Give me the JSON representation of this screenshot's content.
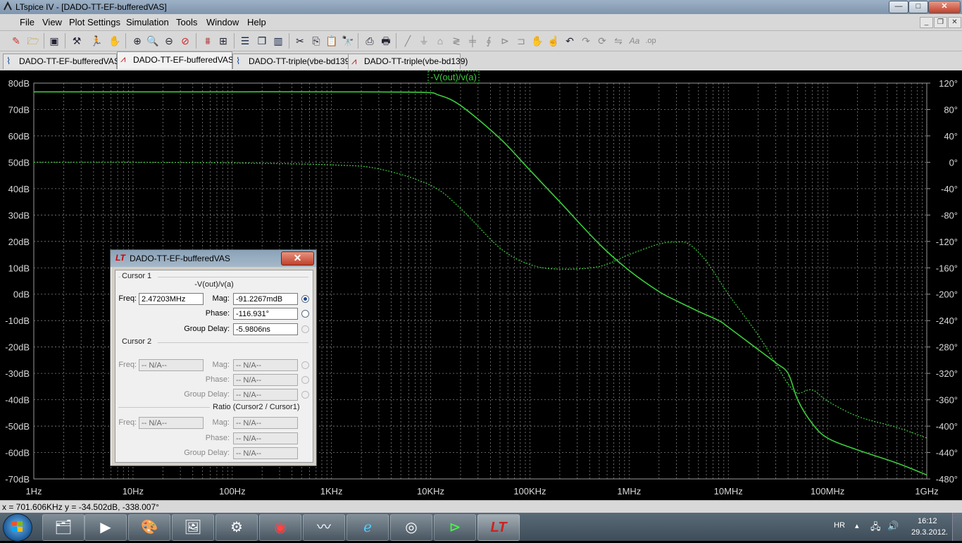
{
  "window": {
    "title": "LTspice IV - [DADO-TT-EF-bufferedVAS]",
    "controls": {
      "minimize": "—",
      "maximize": "□",
      "close": "✕"
    }
  },
  "menu": {
    "items": [
      "File",
      "View",
      "Plot Settings",
      "Simulation",
      "Tools",
      "Window",
      "Help"
    ],
    "mdi_controls": [
      "_",
      "❐",
      "✕"
    ]
  },
  "toolbar": {
    "icons": [
      "new-schematic-icon",
      "open-icon",
      "save-icon",
      "control-panel-icon",
      "run-icon",
      "halt-icon",
      "zoom-in-icon",
      "zoom-box-icon",
      "zoom-out-icon",
      "zoom-cancel-icon",
      "autorange-icon",
      "pan-icon",
      "tile-horizontal-icon",
      "cascade-icon",
      "tile-vertical-icon",
      "cut-icon",
      "copy-icon",
      "paste-icon",
      "find-icon",
      "print-preview-icon",
      "print-icon",
      "wire-icon",
      "ground-icon",
      "label-icon",
      "resistor-icon",
      "capacitor-icon",
      "inductor-icon",
      "diode-icon",
      "component-icon",
      "move-icon",
      "drag-icon",
      "undo-icon",
      "redo-icon",
      "rotate-icon",
      "mirror-icon",
      "text-icon",
      "spice-directive-icon"
    ]
  },
  "tabs": [
    {
      "label": "DADO-TT-EF-bufferedVAS",
      "kind": "schematic",
      "active": false
    },
    {
      "label": "DADO-TT-EF-bufferedVAS",
      "kind": "waveform",
      "active": true
    },
    {
      "label": "DADO-TT-triple(vbe-bd139)",
      "kind": "schematic",
      "active": false
    },
    {
      "label": "DADO-TT-triple(vbe-bd139)",
      "kind": "waveform",
      "active": false
    }
  ],
  "chart_data": {
    "type": "line",
    "title": "-V(out)/v(a)",
    "x_scale": "log",
    "xlim": [
      1,
      1000000000
    ],
    "x_ticks": [
      "1Hz",
      "10Hz",
      "100Hz",
      "1KHz",
      "10KHz",
      "100KHz",
      "1MHz",
      "10MHz",
      "100MHz",
      "1GHz"
    ],
    "ylim": [
      -70,
      80
    ],
    "y_ticks": [
      "80dB",
      "70dB",
      "60dB",
      "50dB",
      "40dB",
      "30dB",
      "20dB",
      "10dB",
      "0dB",
      "-10dB",
      "-20dB",
      "-30dB",
      "-40dB",
      "-50dB",
      "-60dB",
      "-70dB"
    ],
    "y2lim": [
      -480,
      120
    ],
    "y2_ticks": [
      "120°",
      "80°",
      "40°",
      "0°",
      "-40°",
      "-80°",
      "-120°",
      "-160°",
      "-200°",
      "-240°",
      "-280°",
      "-320°",
      "-360°",
      "-400°",
      "-440°",
      "-480°"
    ],
    "grid": true,
    "colors": {
      "trace": "#3ccc3c",
      "grid": "#808080",
      "background": "#000000"
    },
    "series": [
      {
        "name": "magnitude",
        "axis": "left",
        "x": [
          1,
          10,
          100,
          1000,
          8000,
          12000,
          20000,
          50000,
          100000,
          200000,
          500000,
          1000000,
          2000000,
          3000000,
          5000000,
          8000000,
          10000000,
          20000000,
          30000000,
          40000000,
          50000000,
          70000000,
          100000000,
          200000000,
          500000000,
          1000000000
        ],
        "y": [
          76.7,
          76.7,
          76.7,
          76.7,
          76.5,
          75.5,
          71.5,
          59,
          47,
          35,
          19,
          9,
          1,
          -2.5,
          -6.5,
          -10,
          -12.5,
          -21,
          -26,
          -30,
          -40,
          -49,
          -54.5,
          -59,
          -64,
          -68.5
        ]
      },
      {
        "name": "phase",
        "axis": "right",
        "x": [
          1,
          10,
          100,
          1000,
          3000,
          10000,
          20000,
          50000,
          100000,
          200000,
          500000,
          1000000,
          2000000,
          3000000,
          4000000,
          6000000,
          10000000,
          20000000,
          30000000,
          40000000,
          50000000,
          70000000,
          100000000,
          200000000,
          500000000,
          1000000000
        ],
        "y": [
          0,
          0,
          -1,
          -4,
          -10,
          -35,
          -70,
          -130,
          -155,
          -162,
          -158,
          -140,
          -124,
          -121,
          -124,
          -150,
          -200,
          -262,
          -305,
          -336,
          -350,
          -345,
          -362,
          -385,
          -402,
          -418
        ]
      }
    ]
  },
  "cursor_dialog": {
    "title": "DADO-TT-EF-bufferedVAS",
    "logo": "LT",
    "close": "✕",
    "cursor1": {
      "group": "Cursor 1",
      "trace": "-V(out)/v(a)",
      "freq_label": "Freq:",
      "freq": "2.47203MHz",
      "mag_label": "Mag:",
      "mag": "-91.2267mdB",
      "phase_label": "Phase:",
      "phase": "-116.931°",
      "gd_label": "Group Delay:",
      "gd": "-5.9806ns"
    },
    "cursor2": {
      "group": "Cursor 2",
      "freq_label": "Freq:",
      "freq": "-- N/A--",
      "mag_label": "Mag:",
      "mag": "-- N/A--",
      "phase_label": "Phase:",
      "phase": "-- N/A--",
      "gd_label": "Group Delay:",
      "gd": "-- N/A--"
    },
    "ratio": {
      "group": "Ratio (Cursor2 / Cursor1)",
      "freq_label": "Freq:",
      "freq": "-- N/A--",
      "mag_label": "Mag:",
      "mag": "-- N/A--",
      "phase_label": "Phase:",
      "phase": "-- N/A--",
      "gd_label": "Group Delay:",
      "gd": "-- N/A--"
    }
  },
  "status": {
    "text": "x = 701.606KHz    y = -34.502dB, -338.007°"
  },
  "taskbar": {
    "apps": [
      "explorer-icon",
      "media-player-icon",
      "paint-icon",
      "desktop-icon",
      "tool-icon",
      "browser-red-icon",
      "oscilloscope-icon",
      "internet-explorer-icon",
      "media-center-icon",
      "terminal-icon",
      "ltspice-icon"
    ],
    "language": "HR",
    "time": "16:12",
    "date": "29.3.2012."
  }
}
